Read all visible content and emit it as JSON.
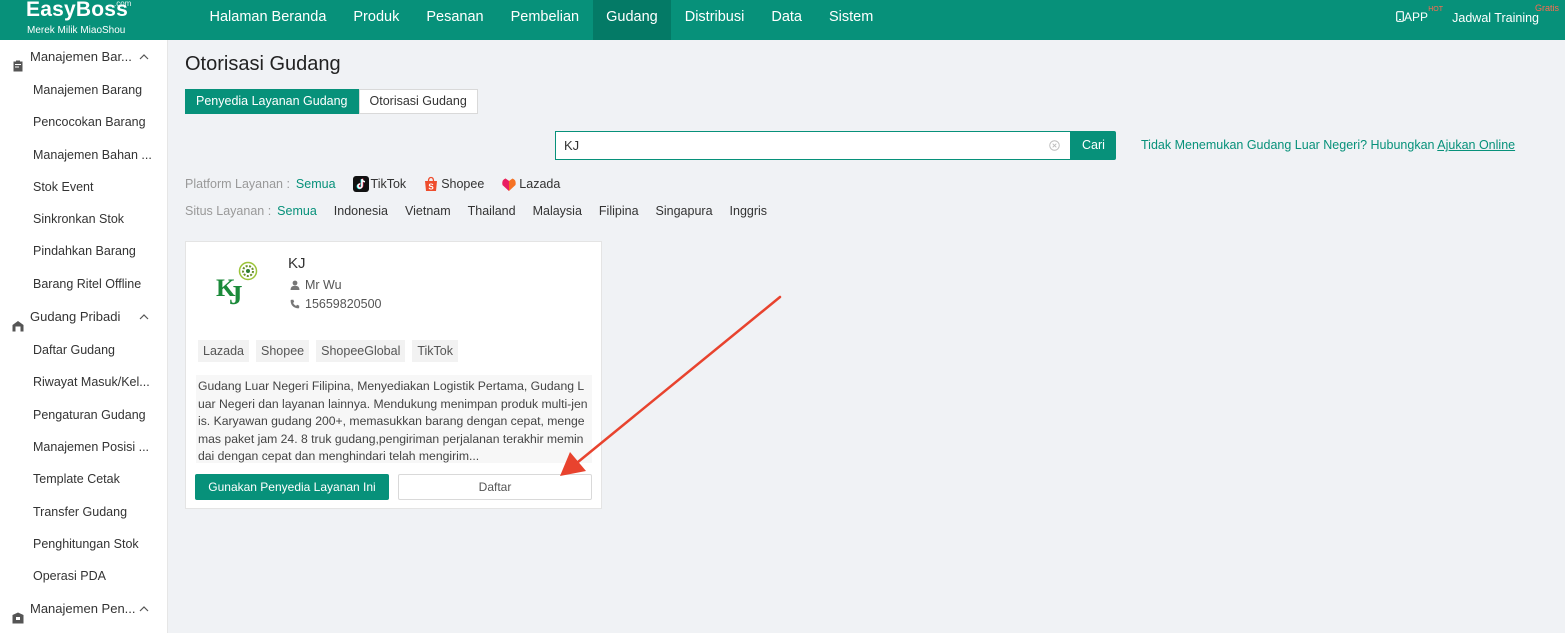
{
  "app": {
    "brand": "EasyBoss",
    "brand_suffix": ".com",
    "brand_sub": "Merek Milik MiaoShou"
  },
  "nav": {
    "items": [
      {
        "label": "Halaman Beranda",
        "active": false
      },
      {
        "label": "Produk",
        "active": false
      },
      {
        "label": "Pesanan",
        "active": false
      },
      {
        "label": "Pembelian",
        "active": false
      },
      {
        "label": "Gudang",
        "active": true
      },
      {
        "label": "Distribusi",
        "active": false
      },
      {
        "label": "Data",
        "active": false
      },
      {
        "label": "Sistem",
        "active": false
      }
    ],
    "app_label": "APP",
    "hot_badge": "HOT",
    "training_label": "Jadwal Training",
    "free_badge": "Gratis"
  },
  "sidebar": {
    "groups": [
      {
        "title": "Manajemen Bar...",
        "icon": "clipboard-icon",
        "items": [
          "Manajemen Barang",
          "Pencocokan Barang",
          "Manajemen Bahan ...",
          "Stok Event",
          "Sinkronkan Stok",
          "Pindahkan Barang",
          "Barang Ritel Offline"
        ]
      },
      {
        "title": "Gudang Pribadi",
        "icon": "warehouse-icon",
        "items": [
          "Daftar Gudang",
          "Riwayat Masuk/Kel...",
          "Pengaturan Gudang",
          "Manajemen Posisi ...",
          "Template Cetak",
          "Transfer Gudang",
          "Penghitungan Stok",
          "Operasi PDA"
        ]
      },
      {
        "title": "Manajemen Pen...",
        "icon": "box-icon",
        "items": []
      }
    ]
  },
  "main": {
    "title": "Otorisasi Gudang",
    "tabs": [
      {
        "label": "Penyedia Layanan Gudang",
        "active": true
      },
      {
        "label": "Otorisasi Gudang",
        "active": false
      }
    ],
    "search": {
      "value": "KJ",
      "button_label": "Cari"
    },
    "notice": {
      "text": "Tidak Menemukan Gudang Luar Negeri? Hubungkan ",
      "link_label": "Ajukan Online"
    },
    "platform_filter": {
      "label": "Platform Layanan :",
      "options": [
        {
          "label": "Semua",
          "active": true,
          "icon": ""
        },
        {
          "label": "TikTok",
          "active": false,
          "icon": "tiktok-icon"
        },
        {
          "label": "Shopee",
          "active": false,
          "icon": "shopee-icon"
        },
        {
          "label": "Lazada",
          "active": false,
          "icon": "lazada-icon"
        }
      ]
    },
    "site_filter": {
      "label": "Situs Layanan :",
      "options": [
        {
          "label": "Semua",
          "active": true
        },
        {
          "label": "Indonesia",
          "active": false
        },
        {
          "label": "Vietnam",
          "active": false
        },
        {
          "label": "Thailand",
          "active": false
        },
        {
          "label": "Malaysia",
          "active": false
        },
        {
          "label": "Filipina",
          "active": false
        },
        {
          "label": "Singapura",
          "active": false
        },
        {
          "label": "Inggris",
          "active": false
        }
      ]
    },
    "provider_card": {
      "name": "KJ",
      "contact": "Mr Wu",
      "phone": "15659820500",
      "tags": [
        "Lazada",
        "Shopee",
        "ShopeeGlobal",
        "TikTok"
      ],
      "description": "Gudang Luar Negeri Filipina, Menyediakan Logistik Pertama, Gudang Luar Negeri dan layanan lainnya. Mendukung menimpan produk multi-jenis. Karyawan gudang 200+, memasukkan barang dengan cepat, mengemas paket jam 24. 8 truk gudang,pengiriman perjalanan terakhir memindai dengan cepat dan menghindari telah mengirim...",
      "use_button": "Gunakan Penyedia Layanan Ini",
      "register_button": "Daftar"
    }
  },
  "colors": {
    "primary": "#07917a",
    "primary_dark": "#047a66",
    "annotation_arrow": "#e8432e",
    "badge": "#ff6a50"
  }
}
